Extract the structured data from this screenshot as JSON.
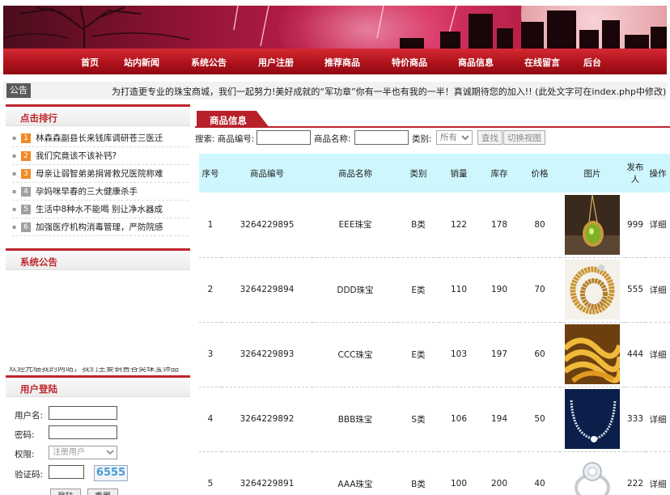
{
  "nav": {
    "items": [
      "首页",
      "站内新闻",
      "系统公告",
      "用户注册",
      "推荐商品",
      "特价商品",
      "商品信息",
      "在线留言",
      "后台"
    ]
  },
  "announce": {
    "label": "公告",
    "text": "为打造更专业的珠宝商城，我们一起努力!美好成就的“军功章”你有一半也有我的一半！真诚期待您的加入!! (此处文字可在index.php中修改)"
  },
  "sidebar": {
    "hot": {
      "title": "点击排行",
      "items": [
        {
          "num": "1",
          "text": "林森森副县长来钱库调研苍三医迁"
        },
        {
          "num": "2",
          "text": "我们究竟该不该补钙?"
        },
        {
          "num": "3",
          "text": "母亲让弱智弟弟捐肾救兄医院称难"
        },
        {
          "num": "4",
          "text": "孕妈咪早春的三大健康杀手"
        },
        {
          "num": "5",
          "text": "生活中8种水不能喝 别让净水器成"
        },
        {
          "num": "6",
          "text": "加强医疗机构消毒管理，严防院感"
        }
      ]
    },
    "notice": {
      "title": "系统公告",
      "ticker": "欢迎光临我的网站，我们主要销售各类珠宝饰品"
    },
    "login": {
      "title": "用户登陆",
      "username_label": "用户名:",
      "password_label": "密码:",
      "role_label": "权限:",
      "role_value": "注册用户",
      "captcha_label": "验证码:",
      "captcha_code": "6555",
      "login_button": "登陆",
      "reset_button": "重置"
    }
  },
  "main": {
    "tab_label": "商品信息",
    "search": {
      "prefix": "搜索: 商品编号:",
      "name_label": "商品名称:",
      "category_label": "类别:",
      "category_value": "所有",
      "search_button": "查找",
      "toggle_button": "切换视图"
    },
    "table": {
      "headers": [
        "序号",
        "商品编号",
        "商品名称",
        "类别",
        "销量",
        "库存",
        "价格",
        "图片",
        "发布人",
        "操作"
      ],
      "rows": [
        {
          "seq": "1",
          "code": "3264229895",
          "name": "EEE珠宝",
          "cat": "B类",
          "sales": "122",
          "stock": "178",
          "price": "80",
          "image": "pendant-image",
          "publisher": "999",
          "action": "详细"
        },
        {
          "seq": "2",
          "code": "3264229894",
          "name": "DDD珠宝",
          "cat": "E类",
          "sales": "110",
          "stock": "190",
          "price": "70",
          "image": "beads-image",
          "publisher": "555",
          "action": "详细"
        },
        {
          "seq": "3",
          "code": "3264229893",
          "name": "CCC珠宝",
          "cat": "E类",
          "sales": "103",
          "stock": "197",
          "price": "60",
          "image": "gold-chain-image",
          "publisher": "444",
          "action": "详细"
        },
        {
          "seq": "4",
          "code": "3264229892",
          "name": "BBB珠宝",
          "cat": "S类",
          "sales": "106",
          "stock": "194",
          "price": "50",
          "image": "necklace-image",
          "publisher": "333",
          "action": "详细"
        },
        {
          "seq": "5",
          "code": "3264229891",
          "name": "AAA珠宝",
          "cat": "B类",
          "sales": "100",
          "stock": "200",
          "price": "40",
          "image": "ring-image",
          "publisher": "222",
          "action": "详细"
        }
      ]
    }
  },
  "colors": {
    "accent": "#c0252c",
    "nav": "#b0121c",
    "table_header": "#cdf7fd",
    "rank_top": "#f08a24",
    "rank_other": "#a0a0a0"
  }
}
